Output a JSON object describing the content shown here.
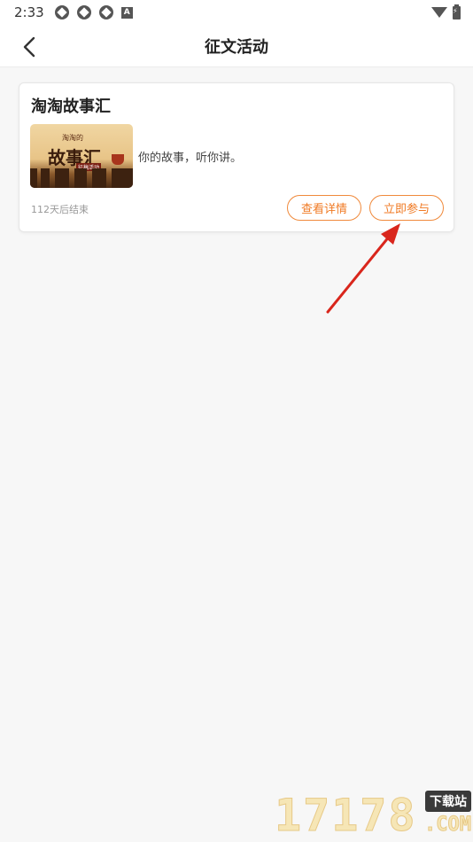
{
  "status_bar": {
    "time": "2:33",
    "notification_icons": [
      "notification-icon",
      "notification-icon",
      "notification-icon"
    ],
    "a_icon_label": "A",
    "right_icons": [
      "wifi-icon",
      "battery-icon"
    ]
  },
  "header": {
    "title": "征文活动",
    "back_icon": "chevron-left-icon"
  },
  "activities": [
    {
      "title": "淘淘故事汇",
      "thumbnail": {
        "title": "故事汇",
        "subtitle": "淘淘的",
        "tag": "征稿活动"
      },
      "description": "你的故事，听你讲。",
      "remaining": "112天后结束",
      "detail_button": "查看详情",
      "join_button": "立即参与"
    }
  ],
  "watermark": {
    "digits": "17178",
    "tag": "下载站",
    "com": ".COM"
  },
  "colors": {
    "accent": "#f07a24",
    "annotation_arrow": "#d9261c"
  }
}
